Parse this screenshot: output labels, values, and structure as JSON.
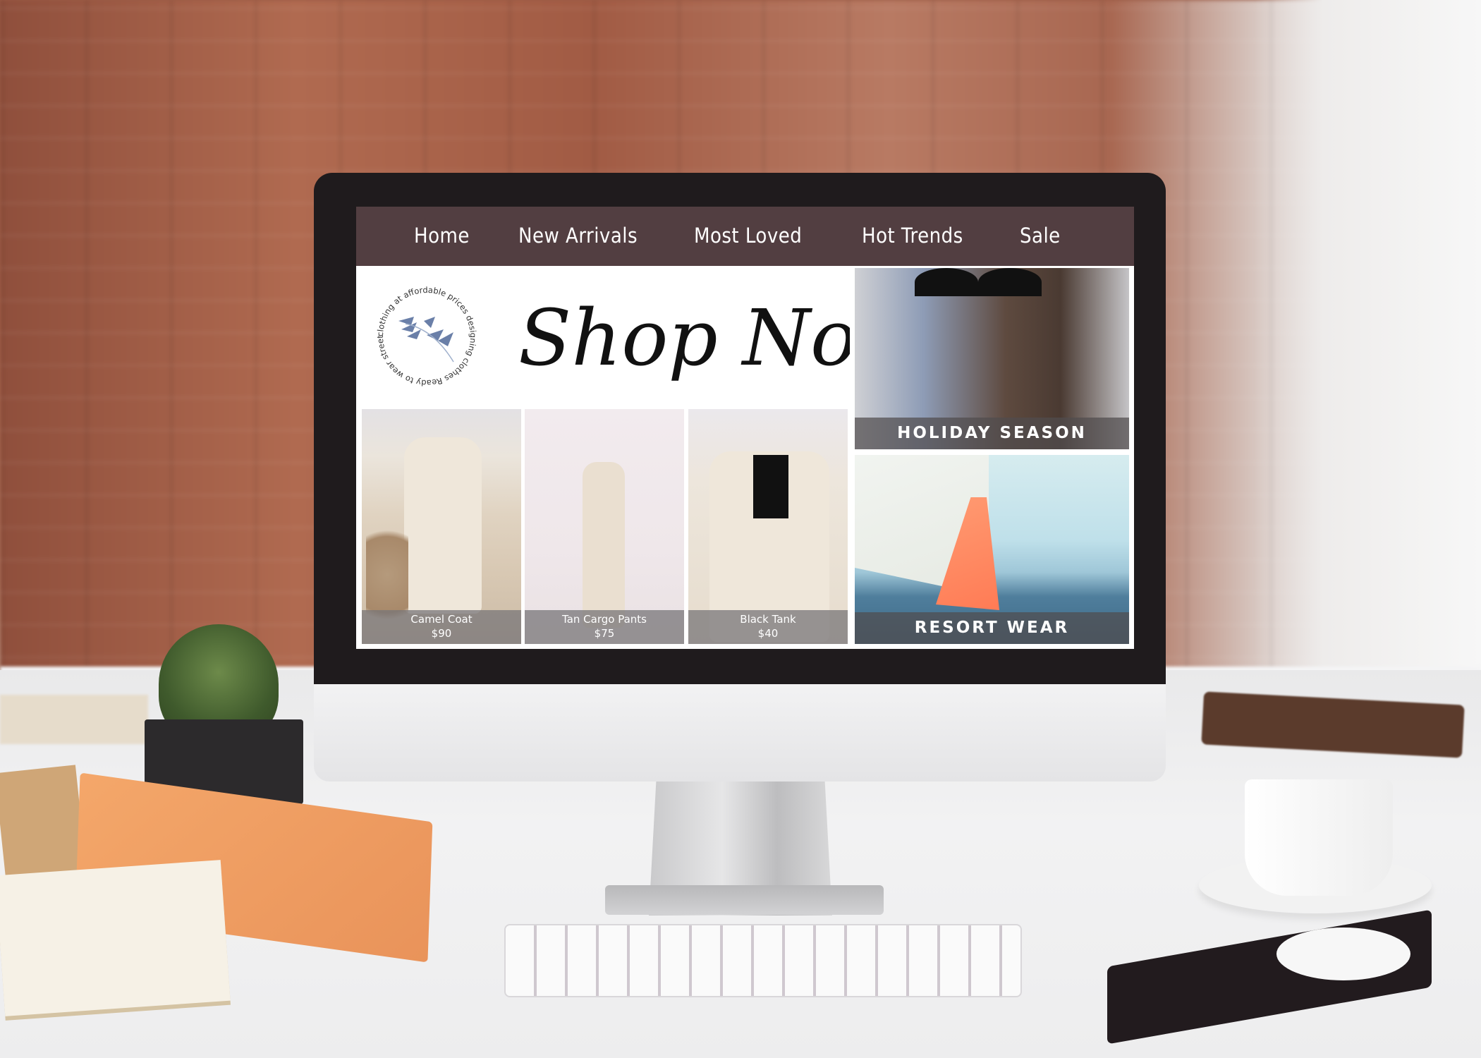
{
  "nav": {
    "items": [
      {
        "label": "Home"
      },
      {
        "label": "New Arrivals"
      },
      {
        "label": "Most Loved"
      },
      {
        "label": "Hot Trends"
      },
      {
        "label": "Sale"
      }
    ]
  },
  "colors": {
    "nav_bg": "#523e41",
    "nav_text": "#ffffff",
    "logo_leaf": "#6a7fa8",
    "caption_bg": "#7f7c7f",
    "band_bg": "#504c4e"
  },
  "logo": {
    "ring_text": "clothing at affordable prices designing clothes   Ready to wear street style ",
    "icon": "leaf-branch-icon"
  },
  "hero": {
    "script_title": "Shop Now"
  },
  "products": [
    {
      "name": "Camel Coat",
      "price": "$90"
    },
    {
      "name": "Tan Cargo Pants",
      "price": "$75"
    },
    {
      "name": "Black Tank",
      "price": "$40"
    }
  ],
  "promos": [
    {
      "label": "HOLIDAY SEASON"
    },
    {
      "label": "RESORT WEAR"
    }
  ]
}
